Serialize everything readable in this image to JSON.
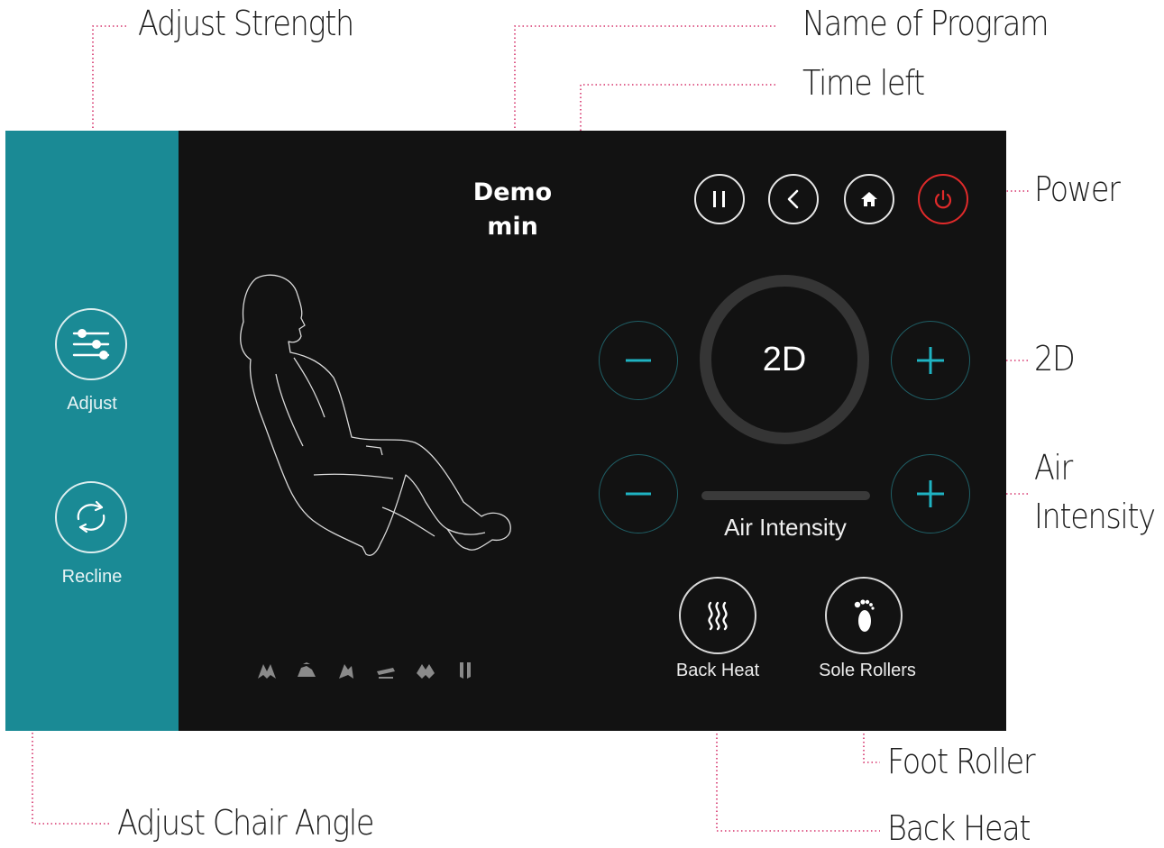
{
  "callouts": {
    "adjust_strength": "Adjust Strength",
    "name_of_program": "Name of Program",
    "time_left": "Time left",
    "power": "Power",
    "two_d": "2D",
    "air_line1": "Air",
    "air_line2": "Intensity",
    "foot_roller": "Foot Roller",
    "adjust_chair_angle": "Adjust Chair Angle",
    "back_heat": "Back Heat"
  },
  "sidebar": {
    "items": [
      {
        "label": "Adjust",
        "icon": "sliders-icon"
      },
      {
        "label": "Recline",
        "icon": "recline-arrows-icon"
      }
    ]
  },
  "program": {
    "name": "Demo",
    "time": "min"
  },
  "top_controls": [
    {
      "icon": "pause-icon"
    },
    {
      "icon": "back-chevron-icon"
    },
    {
      "icon": "home-icon"
    },
    {
      "icon": "power-icon",
      "color": "#e02a2a"
    }
  ],
  "strength": {
    "mode": "2D"
  },
  "air": {
    "label": "Air Intensity",
    "level": 0
  },
  "features": [
    {
      "label": "Back Heat",
      "icon": "heat-waves-icon"
    },
    {
      "label": "Sole Rollers",
      "icon": "footprint-icon"
    }
  ],
  "body_positions": [
    "shoulders-icon",
    "back-icon",
    "waist-icon",
    "seat-icon",
    "legs-icon",
    "feet-icon"
  ],
  "colors": {
    "sidebar": "#1a8a95",
    "screen_bg": "#121212",
    "accent": "#1fb3c2",
    "power": "#e02a2a",
    "callout_line": "#d6336c"
  }
}
